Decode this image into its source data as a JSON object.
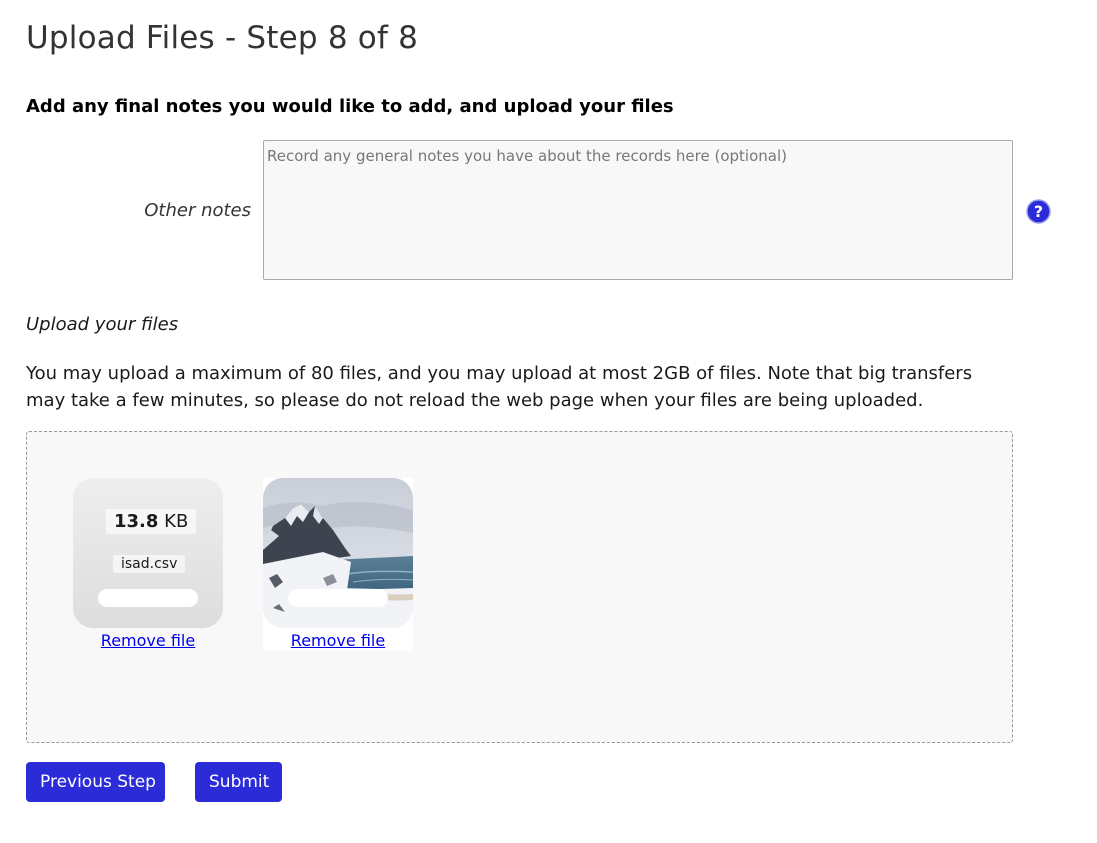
{
  "page": {
    "title": "Upload Files - Step 8 of 8",
    "subtitle": "Add any final notes you would like to add, and upload your files"
  },
  "notes": {
    "label": "Other notes",
    "placeholder": "Record any general notes you have about the records here (optional)",
    "value": "",
    "help_icon": "question-circle-icon"
  },
  "upload": {
    "label": "Upload your files",
    "info": "You may upload a maximum of 80 files, and you may upload at most 2GB of files. Note that big transfers may take a few minutes, so please do not reload the web page when your files are being uploaded.",
    "files": [
      {
        "size_value": "13.8",
        "size_unit": "KB",
        "name": "isad.csv",
        "remove_label": "Remove file",
        "progress": 1.0
      },
      {
        "thumbnail": "snowy-mountain-coast-photo",
        "remove_label": "Remove file",
        "progress": 1.0
      }
    ]
  },
  "buttons": {
    "previous": "Previous Step",
    "submit": "Submit"
  },
  "colors": {
    "button_bg": "#2b2bd8",
    "link": "#0000ee",
    "help_icon": "#2b2bd8"
  }
}
